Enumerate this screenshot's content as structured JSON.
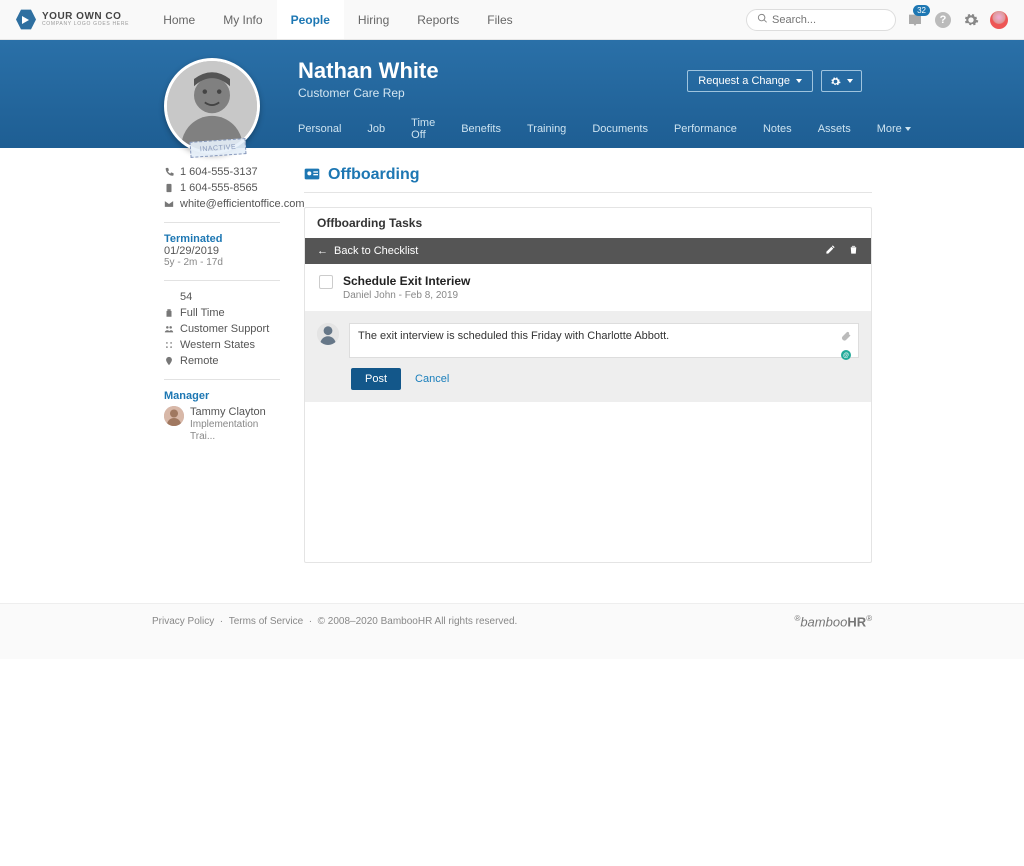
{
  "logo": {
    "main": "YOUR OWN CO",
    "sub": "COMPANY LOGO GOES HERE"
  },
  "topnav": {
    "items": [
      "Home",
      "My Info",
      "People",
      "Hiring",
      "Reports",
      "Files"
    ]
  },
  "search": {
    "placeholder": "Search..."
  },
  "inbox_badge": "32",
  "employee": {
    "name": "Nathan White",
    "title": "Customer Care Rep",
    "phone1": "1 604-555-3137",
    "phone2": "1 604-555-8565",
    "email": "white@efficientoffice.com",
    "status_label": "Terminated",
    "term_date": "01/29/2019",
    "tenure": "5y - 2m - 17d",
    "emp_no": "54",
    "emp_type": "Full Time",
    "dept": "Customer Support",
    "region": "Western States",
    "location": "Remote",
    "stamp": "INACTIVE"
  },
  "hero_actions": {
    "request_change": "Request a Change"
  },
  "subtabs": [
    "Personal",
    "Job",
    "Time Off",
    "Benefits",
    "Training",
    "Documents",
    "Performance",
    "Notes",
    "Assets",
    "More"
  ],
  "manager": {
    "label": "Manager",
    "name": "Tammy Clayton",
    "title": "Implementation Trai..."
  },
  "page_title": "Offboarding",
  "panel": {
    "header": "Offboarding Tasks",
    "back_label": "Back to Checklist",
    "task": {
      "title": "Schedule Exit Interiew",
      "meta": "Daniel John  -  Feb 8, 2019"
    },
    "comment_value": "The exit interview is scheduled this Friday with Charlotte Abbott.",
    "post": "Post",
    "cancel": "Cancel"
  },
  "footer": {
    "privacy": "Privacy Policy",
    "tos": "Terms of Service",
    "copyright": "© 2008–2020 BambooHR All rights reserved.",
    "brand_prefix": "bamboo",
    "brand_suffix": "HR"
  }
}
